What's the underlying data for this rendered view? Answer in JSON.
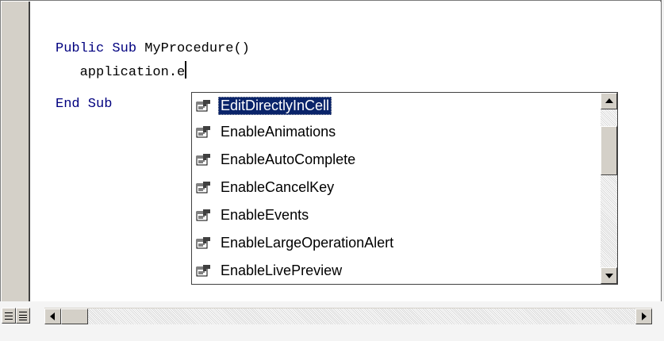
{
  "code": {
    "line1_kw": "Public Sub",
    "line1_name": " MyProcedure()",
    "line2": "   application.e",
    "line3_kw": "End Sub"
  },
  "autocomplete": {
    "items": [
      {
        "label": "EditDirectlyInCell",
        "selected": true,
        "icon": "property-icon"
      },
      {
        "label": "EnableAnimations",
        "selected": false,
        "icon": "property-icon"
      },
      {
        "label": "EnableAutoComplete",
        "selected": false,
        "icon": "property-icon"
      },
      {
        "label": "EnableCancelKey",
        "selected": false,
        "icon": "property-icon"
      },
      {
        "label": "EnableEvents",
        "selected": false,
        "icon": "property-icon"
      },
      {
        "label": "EnableLargeOperationAlert",
        "selected": false,
        "icon": "property-icon"
      },
      {
        "label": "EnableLivePreview",
        "selected": false,
        "icon": "property-icon"
      }
    ]
  },
  "colors": {
    "keyword": "#00007f",
    "selection": "#0a246a",
    "chrome": "#d4d0c8"
  }
}
